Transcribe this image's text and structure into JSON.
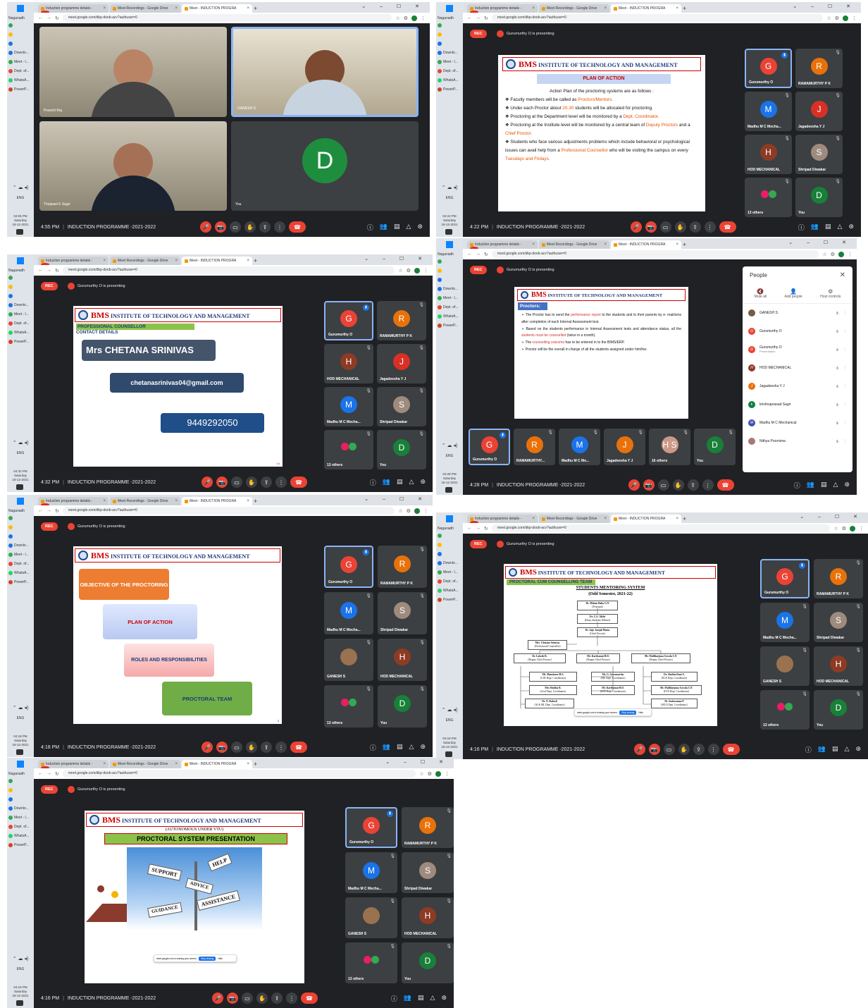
{
  "tabs": [
    "Induction programme details - ",
    "Meet Recordings - Google Drive",
    "Meet - INDUCTION PROGRA"
  ],
  "url": "meet.google.com/dkp-doob-acv?authuser=0",
  "account": "Naganadh",
  "taskbar_items": [
    "Downlo...",
    "Meet - l...",
    "Dept. of...",
    "WhatsA...",
    "PowerP..."
  ],
  "lang": "ENG",
  "meeting_title": "INDUCTION PROGRAMME -2021-2022",
  "rec": "REC",
  "presenting": "Gurumurthy O is presenting",
  "shots": [
    {
      "time": "4:55 PM",
      "clock": "04:55 PM\nSaturday\n18-12-2021",
      "cams": [
        {
          "name": "Pranchi Raj"
        },
        {
          "name": "GANESH S"
        },
        {
          "name": "Thejaswi K Sagri"
        },
        {
          "name": "You",
          "letter": "D"
        }
      ]
    },
    {
      "time": "4:22 PM",
      "clock": "04:22 PM\nSaturday\n18-12-2021",
      "slide": {
        "institute_big": "BMS",
        "institute_rest": "INSTITUTE OF TECHNOLOGY AND MANAGEMENT",
        "heading": "PLAN OF ACTION",
        "intro": "Action Plan of the proctoring systems are as follows :",
        "b1a": "Faculty members will be called as ",
        "b1b": "Proctors/Mentors.",
        "b2a": "Under each Proctor about ",
        "b2b": "20-30",
        "b2c": " students will be allocated for proctoring.",
        "b3a": "Proctoring at the Department level will be monitored by a ",
        "b3b": "Dept. Coordinator.",
        "b4a": "Proctoring at the Institute level will be monitored by a central team of ",
        "b4b": "Deputy Proctors",
        "b4c": " and a ",
        "b4d": "Chief Proctor.",
        "b5a": "Students who face various adjustments problems which include behavioral or psychological issues can avail help from a ",
        "b5b": "Professional Counsellor",
        "b5c": " who will be visiting the campus on every ",
        "b5d": "Tuesdays and Fridays."
      }
    },
    {
      "time": "4:32 PM",
      "clock": "04:32 PM\nSaturday\n18-12-2021",
      "slide": {
        "l1": "PROFESSIONAL COUNSELLOR",
        "l2": "CONTACT DETAILS",
        "name": "Mrs CHETANA SRINIVAS",
        "email": "chetanasrinivas04@gmail.com",
        "phone": "9449292050",
        "page": "14"
      }
    },
    {
      "time": "4:28 PM",
      "clock": "04:28 PM\nSaturday\n18-12-2021",
      "slide": {
        "heading": "Proctors:",
        "p1a": "The Proctor has to send the ",
        "p1b": "performance report",
        "p1c": " to the students and to their parents by e- mail/sms after completion of each Internal Assessment test.",
        "p2a": "Based on the students performance in Internal Assessment tests and attendance status, all the ",
        "p2b": "students must be counselled",
        "p2c": " (twice in a month).",
        "p3a": "The ",
        "p3b": "counselling outcome",
        "p3c": " has to be entered in to the BIMS/ERP.",
        "p4": "Proctor will be the overall in charge of all the students assigned under him/her."
      },
      "people": {
        "title": "People",
        "ops": [
          "Mute all",
          "Add people",
          "Host controls"
        ],
        "rows": [
          {
            "name": "GANESH S",
            "color": "#7a5a40",
            "letter": ""
          },
          {
            "name": "Gurumurthy O",
            "color": "#ea4335",
            "letter": "G"
          },
          {
            "name": "Gurumurthy O",
            "sub": "Presentation",
            "color": "#ea4335",
            "letter": "G"
          },
          {
            "name": "HOD MECHANICAL",
            "color": "#8d3b24",
            "letter": "H"
          },
          {
            "name": "Jagadeesha Y J",
            "color": "#e8710a",
            "letter": "J"
          },
          {
            "name": "krishnaprasad Sagri",
            "color": "#0b8043",
            "letter": "k"
          },
          {
            "name": "Madhu M C Mechanical",
            "color": "#3f51b5",
            "letter": "M"
          },
          {
            "name": "Nithya Poornima",
            "color": "#a77",
            "letter": ""
          }
        ]
      }
    },
    {
      "time": "4:18 PM",
      "clock": "04:18 PM\nSaturday\n18-12-2021",
      "slide": {
        "b1": "OBJECTIVE OF THE PROCTORING",
        "b2": "PLAN OF ACTION",
        "b3": "ROLES AND RESPONSIBILITIES",
        "b4": "PROCTORAL TEAM",
        "page": "3"
      }
    },
    {
      "time": "4:16 PM",
      "clock": "04:16 PM\nSaturday\n18-12-2021",
      "slide": {
        "sub": "PROCTORAL CUM COUNSELLING TEAM",
        "title": "STUDENTS MENTORING SYSTEM",
        "sem": "(Odd Semester, 2021-22)",
        "n1": "Dr. Mohan Babu G.N",
        "n1r": "(Principal)",
        "n2": "Dr. C.G. Mohi",
        "n2r": "(Dean, Students Welfare)",
        "n3": "Dr. Jaju Joseph Maria",
        "n3r": "(Chief Proctor)",
        "n4": "Mrs. Chetana Srinivas",
        "n4r": "(Professional Counsellor)",
        "d1": "Dr. Lokesh R.",
        "d1r": "(Deputy Chief Proctor)",
        "d2": "Mr. Karthamai H.D.",
        "d2r": "(Deputy Chief Proctor)",
        "d3": "Mr. Mallikarjuna Gowda C.P.",
        "d3r": "(Deputy Chief Proctor)",
        "c1": "Mr. Manohara M.S.",
        "c1r": "(CSE Dept. Coordinator)",
        "c2": "Mr. G. Gurumurthy",
        "c2r": "(ME Dept. Coordinator)",
        "c3": "Dr. Shobha Rani A.",
        "c3r": "(ECE Dept. Coordinator)",
        "c4": "Mrs Shobha R.",
        "c4r": "(Civil Dept. Coordinator)",
        "c5": "Mr. Karthamai H.D.",
        "c5r": "(EEE Dept. Coordinator)",
        "c6": "Mr. Mallikarjuna Gowda C.P.",
        "c6r": "(ETE Dept. Coordinator)",
        "c7": "Dr. N. Rakesh",
        "c7r": "(AI & ML Dept. Coordinator)",
        "c8": "Dr. Sudarsanan P",
        "c8r": "(MCA Dept. Coordinator)",
        "share": "meet.google.com is sharing your screen.",
        "stop": "Stop sharing",
        "hide": "Hide"
      }
    },
    {
      "time": "4:16 PM",
      "clock": "04:16 PM\nSaturday\n18-12-2021",
      "slide": {
        "auto": "(AUTONOMOUS UNDER VTU)",
        "title": "PROCTORAL SYSTEM PRESENTATION",
        "signs": [
          "SUPPORT",
          "HELP",
          "ADVICE",
          "ASSISTANCE",
          "GUIDANCE"
        ],
        "share": "meet.google.com is sharing your screen.",
        "stop": "Stop sharing",
        "hide": "Hide"
      }
    }
  ],
  "tiles": {
    "gurumurthy": "Gurumurthy O",
    "ramamurthy": "RAMAMURTHY P K",
    "madhu": "Madhu M C Mecha...",
    "jagadeesha": "Jagadeesha Y J",
    "hod": "HOD MECHANICAL",
    "shripad": "Shripad Diwakar",
    "ganesh": "GANESH S",
    "others13": "13 others",
    "others16": "16 others",
    "you": "You",
    "ramamurthy_short": "RAMAMURTHY...",
    "madhu_short": "Madhu M C Me..."
  },
  "colors": {
    "meet_bg": "#202124",
    "tile_bg": "#3c4043",
    "accent_blue": "#8ab4f8",
    "rec_red": "#ea4335"
  }
}
